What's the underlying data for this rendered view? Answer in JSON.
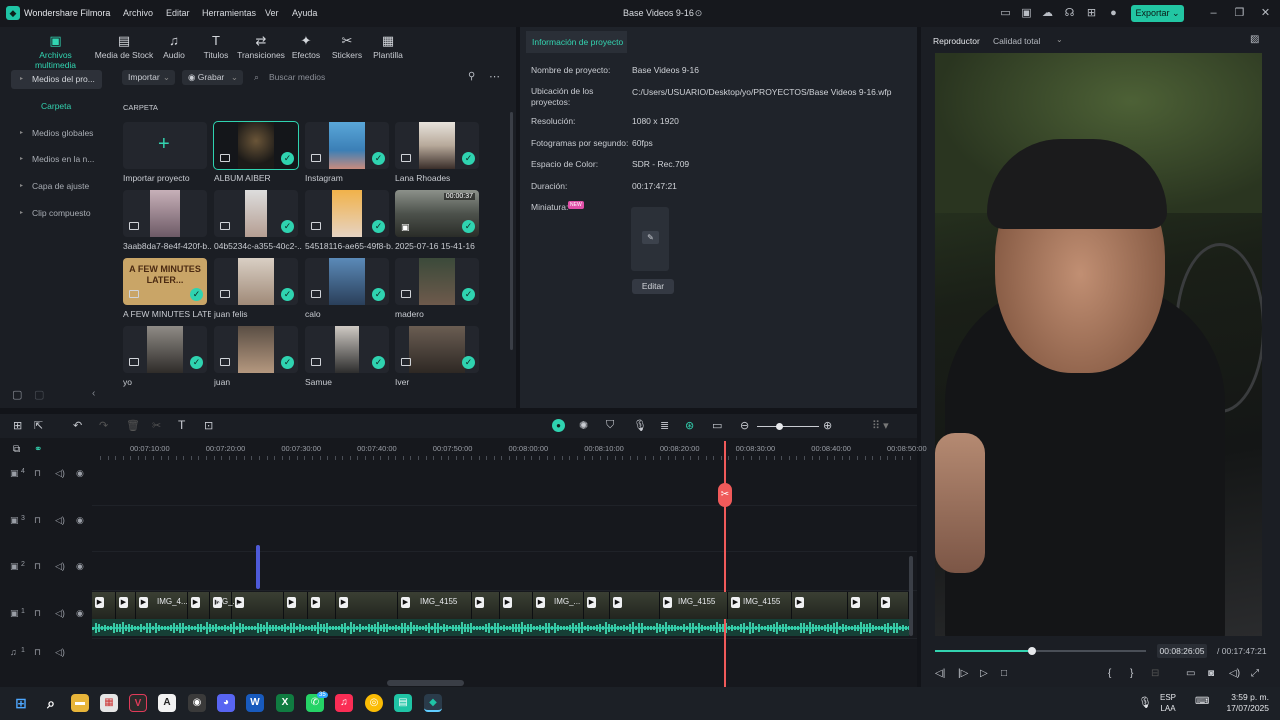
{
  "app": {
    "name": "Wondershare Filmora",
    "project_title": "Base Videos 9-16"
  },
  "menu": [
    "Archivo",
    "Editar",
    "Herramientas",
    "Ver",
    "Ayuda"
  ],
  "export_label": "Exportar",
  "tools": [
    {
      "label": "Archivos multimedia",
      "icon": "media-icon",
      "active": true
    },
    {
      "label": "Media de Stock",
      "icon": "stock-icon"
    },
    {
      "label": "Audio",
      "icon": "music-icon"
    },
    {
      "label": "Titulos",
      "icon": "text-icon"
    },
    {
      "label": "Transiciones",
      "icon": "transition-icon"
    },
    {
      "label": "Efectos",
      "icon": "effects-icon"
    },
    {
      "label": "Stickers",
      "icon": "sticker-icon"
    },
    {
      "label": "Plantilla",
      "icon": "template-icon"
    }
  ],
  "sidebar": {
    "items": [
      "Medios del pro...",
      "Medios globales",
      "Medios en la n...",
      "Capa de ajuste",
      "Clip compuesto"
    ],
    "folder": "Carpeta"
  },
  "media_toolbar": {
    "import": "Importar",
    "record": "Grabar",
    "search_placeholder": "Buscar medios",
    "folder_heading": "CARPETA"
  },
  "media_items": [
    {
      "label": "Importar proyecto",
      "type": "import"
    },
    {
      "label": "ALBUM AIBER",
      "selected": true
    },
    {
      "label": "Instagram"
    },
    {
      "label": "Lana Rhoades"
    },
    {
      "label": "3aab8da7-8e4f-420f-b..."
    },
    {
      "label": "04b5234c-a355-40c2-..."
    },
    {
      "label": "54518116-ae65-49f8-b..."
    },
    {
      "label": "2025-07-16 15-41-16",
      "duration": "00:00:37"
    },
    {
      "label": "A FEW MINUTES LATE...",
      "overlay_text": "A FEW MINUTES LATER..."
    },
    {
      "label": "juan felis"
    },
    {
      "label": "calo"
    },
    {
      "label": "madero"
    },
    {
      "label": "yo"
    },
    {
      "label": "juan"
    },
    {
      "label": "Samue"
    },
    {
      "label": "Iver"
    }
  ],
  "project_info": {
    "tab": "Información de proyecto",
    "fields": [
      {
        "key": "Nombre de proyecto:",
        "value": "Base Videos 9-16"
      },
      {
        "key": "Ubicación de los proyectos:",
        "value": "C:/Users/USUARIO/Desktop/yo/PROYECTOS/Base Videos 9-16.wfp"
      },
      {
        "key": "Resolución:",
        "value": "1080 x 1920"
      },
      {
        "key": "Fotogramas por segundo:",
        "value": "60fps"
      },
      {
        "key": "Espacio de Color:",
        "value": "SDR - Rec.709"
      },
      {
        "key": "Duración:",
        "value": "00:17:47:21"
      },
      {
        "key": "Miniatura:",
        "value": ""
      }
    ],
    "new_badge": "NEW",
    "edit_label": "Editar"
  },
  "player": {
    "tab_player": "Reproductor",
    "tab_quality": "Calidad total",
    "current_time": "00:08:26:05",
    "total_time": "/ 00:17:47:21",
    "progress": 0.46
  },
  "timeline": {
    "ruler": [
      "00:07:10:00",
      "00:07:20:00",
      "00:07:30:00",
      "00:07:40:00",
      "00:07:50:00",
      "00:08:00:00",
      "00:08:10:00",
      "00:08:20:00",
      "00:08:30:00",
      "00:08:40:00",
      "00:08:50:00"
    ],
    "tracks": [
      "4",
      "3",
      "2",
      "1",
      "1"
    ],
    "clip_labels": [
      "IMG_4...",
      "IMG_...",
      "IMG_4155",
      "IMG_...",
      "IMG_4155",
      "IMG_4155"
    ]
  },
  "taskbar": {
    "lang_top": "ESP",
    "lang_bottom": "LAA",
    "time": "3:59 p. m.",
    "date": "17/07/2025",
    "whatsapp_badge": "35"
  }
}
